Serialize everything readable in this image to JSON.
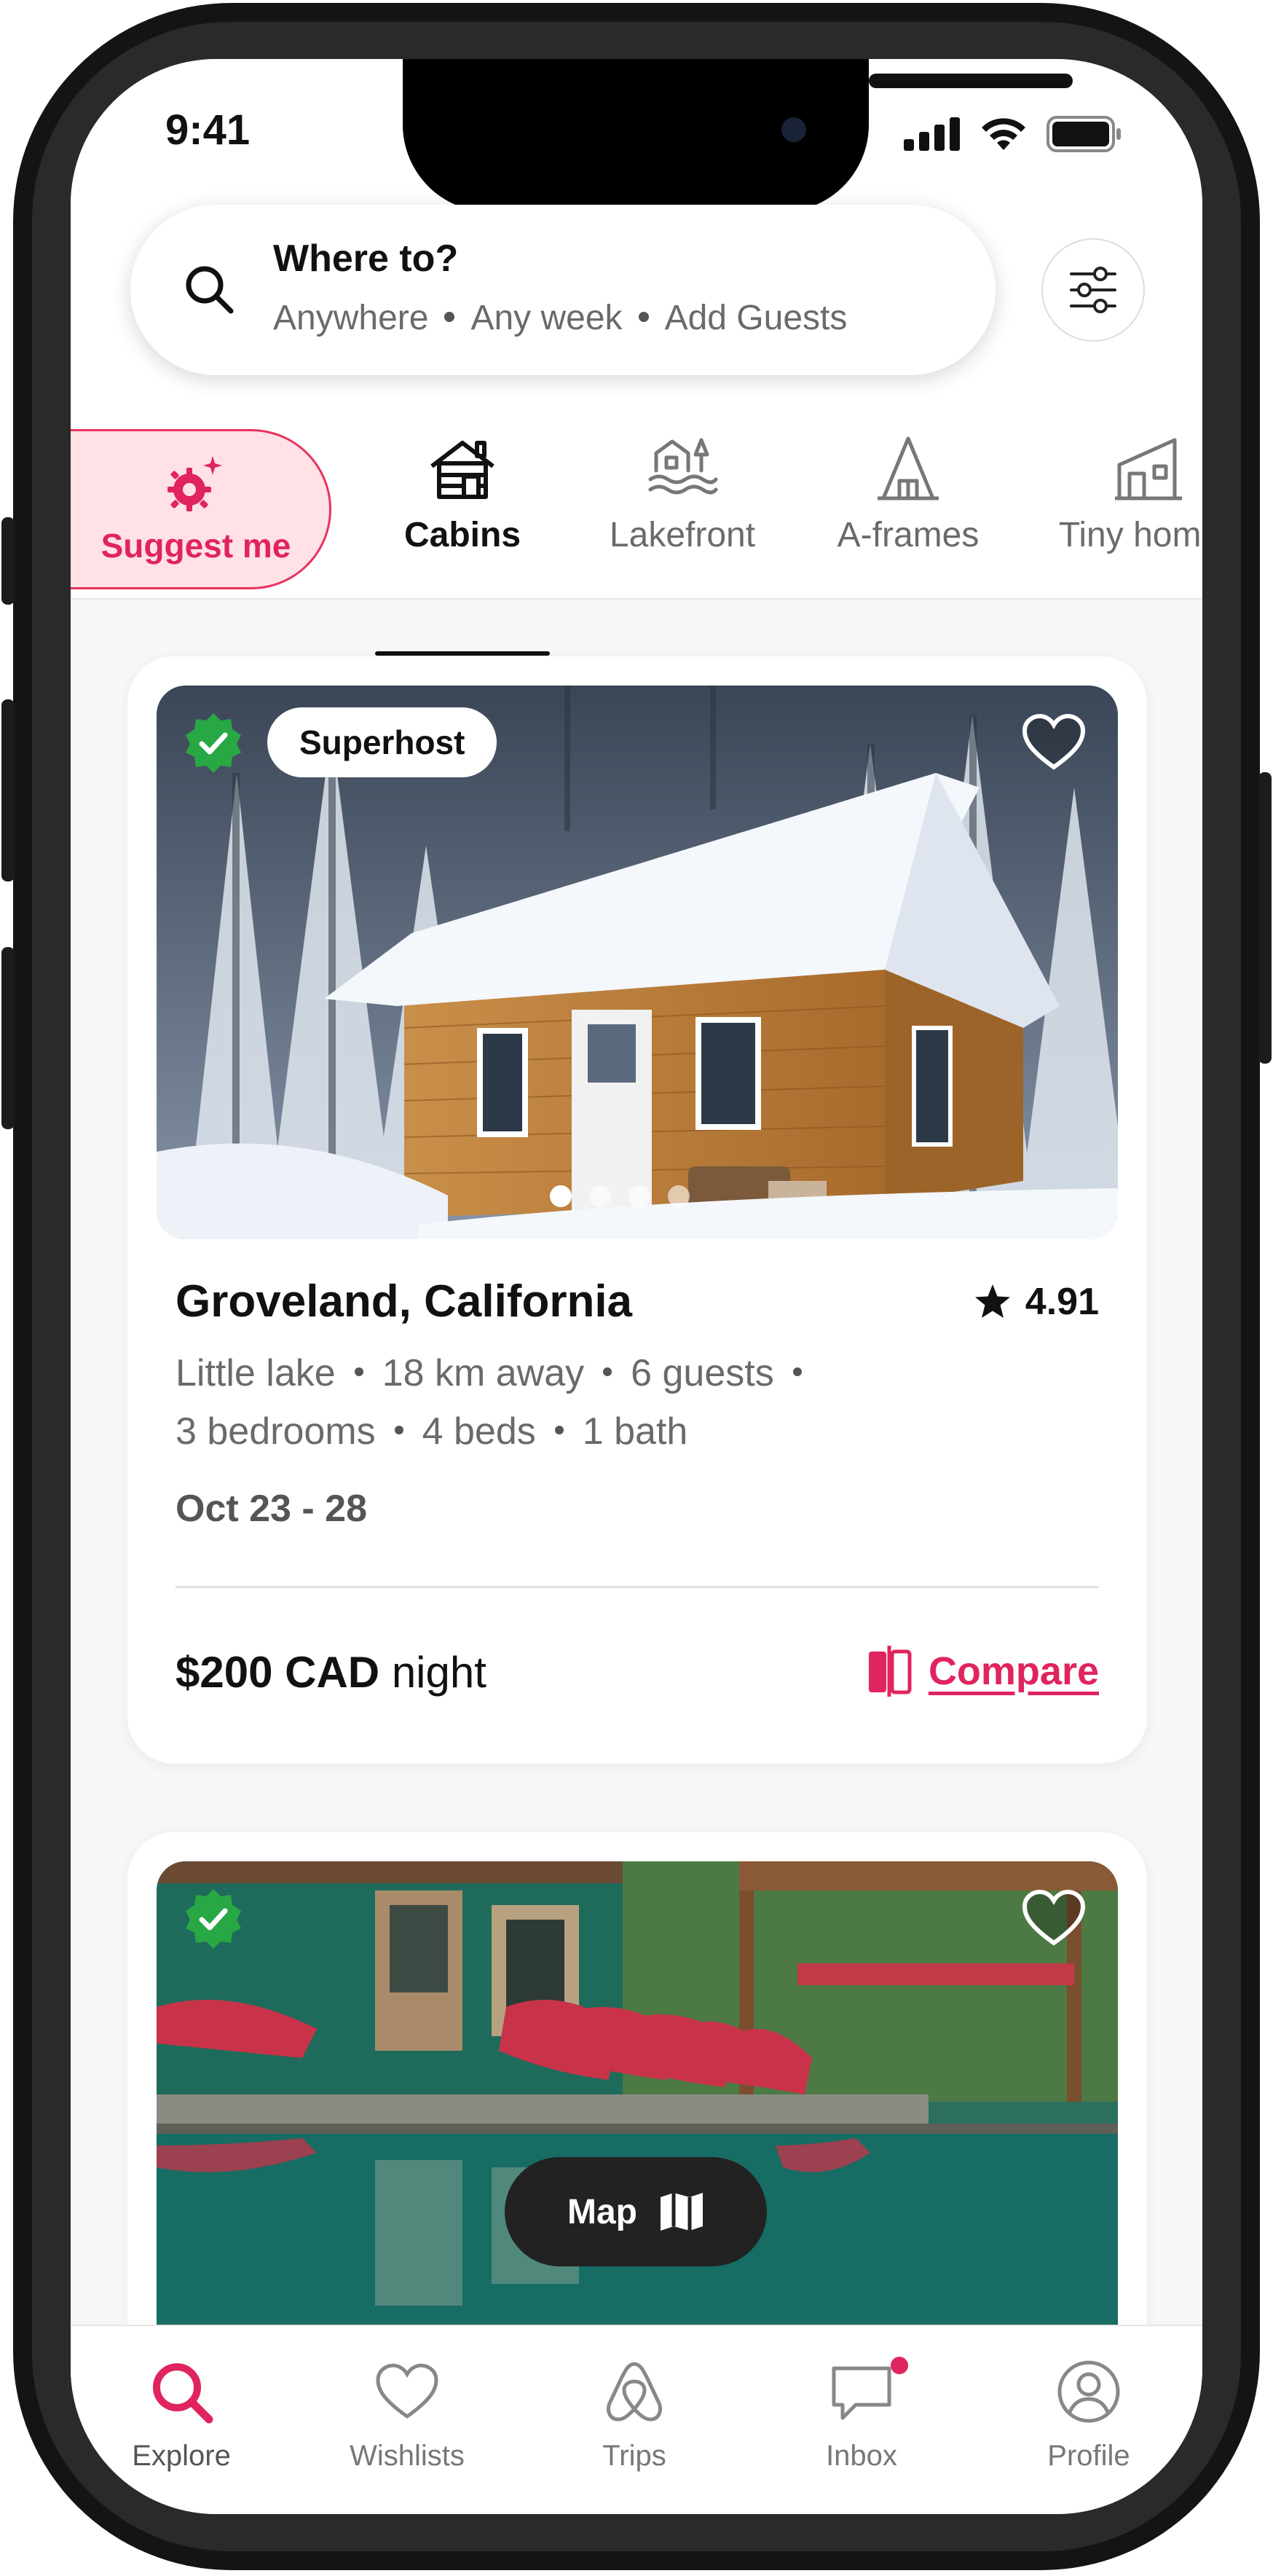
{
  "status": {
    "time": "9:41"
  },
  "search": {
    "title": "Where to?",
    "where": "Anywhere",
    "week": "Any week",
    "guests": "Add Guests"
  },
  "suggest": {
    "label": "Suggest me"
  },
  "categories": [
    {
      "label": "Cabins",
      "icon": "cabin-icon",
      "active": true
    },
    {
      "label": "Lakefront",
      "icon": "lakefront-icon",
      "active": false
    },
    {
      "label": "A-frames",
      "icon": "a-frame-icon",
      "active": false
    },
    {
      "label": "Tiny homes",
      "icon": "tiny-home-icon",
      "active": false
    }
  ],
  "listing": {
    "badge": "Superhost",
    "title": "Groveland, California",
    "rating": "4.91",
    "meta1": [
      "Little lake",
      "18 km away",
      "6 guests"
    ],
    "meta2": [
      "3 bedrooms",
      "4 beds",
      "1 bath"
    ],
    "dates": "Oct 23 - 28",
    "price": "$200 CAD",
    "price_unit": "night",
    "compare": "Compare",
    "photo_index": 4,
    "photo_count": 4
  },
  "map_button": {
    "label": "Map"
  },
  "tabs": [
    {
      "label": "Explore",
      "icon": "search-icon",
      "active": true
    },
    {
      "label": "Wishlists",
      "icon": "heart-icon",
      "active": false
    },
    {
      "label": "Trips",
      "icon": "airbnb-logo-icon",
      "active": false
    },
    {
      "label": "Inbox",
      "icon": "message-icon",
      "active": false,
      "badge": true
    },
    {
      "label": "Profile",
      "icon": "profile-icon",
      "active": false
    }
  ],
  "colors": {
    "accent": "#e0245e",
    "verified": "#28a745",
    "text": "#111111",
    "muted": "#6a6a6a"
  }
}
